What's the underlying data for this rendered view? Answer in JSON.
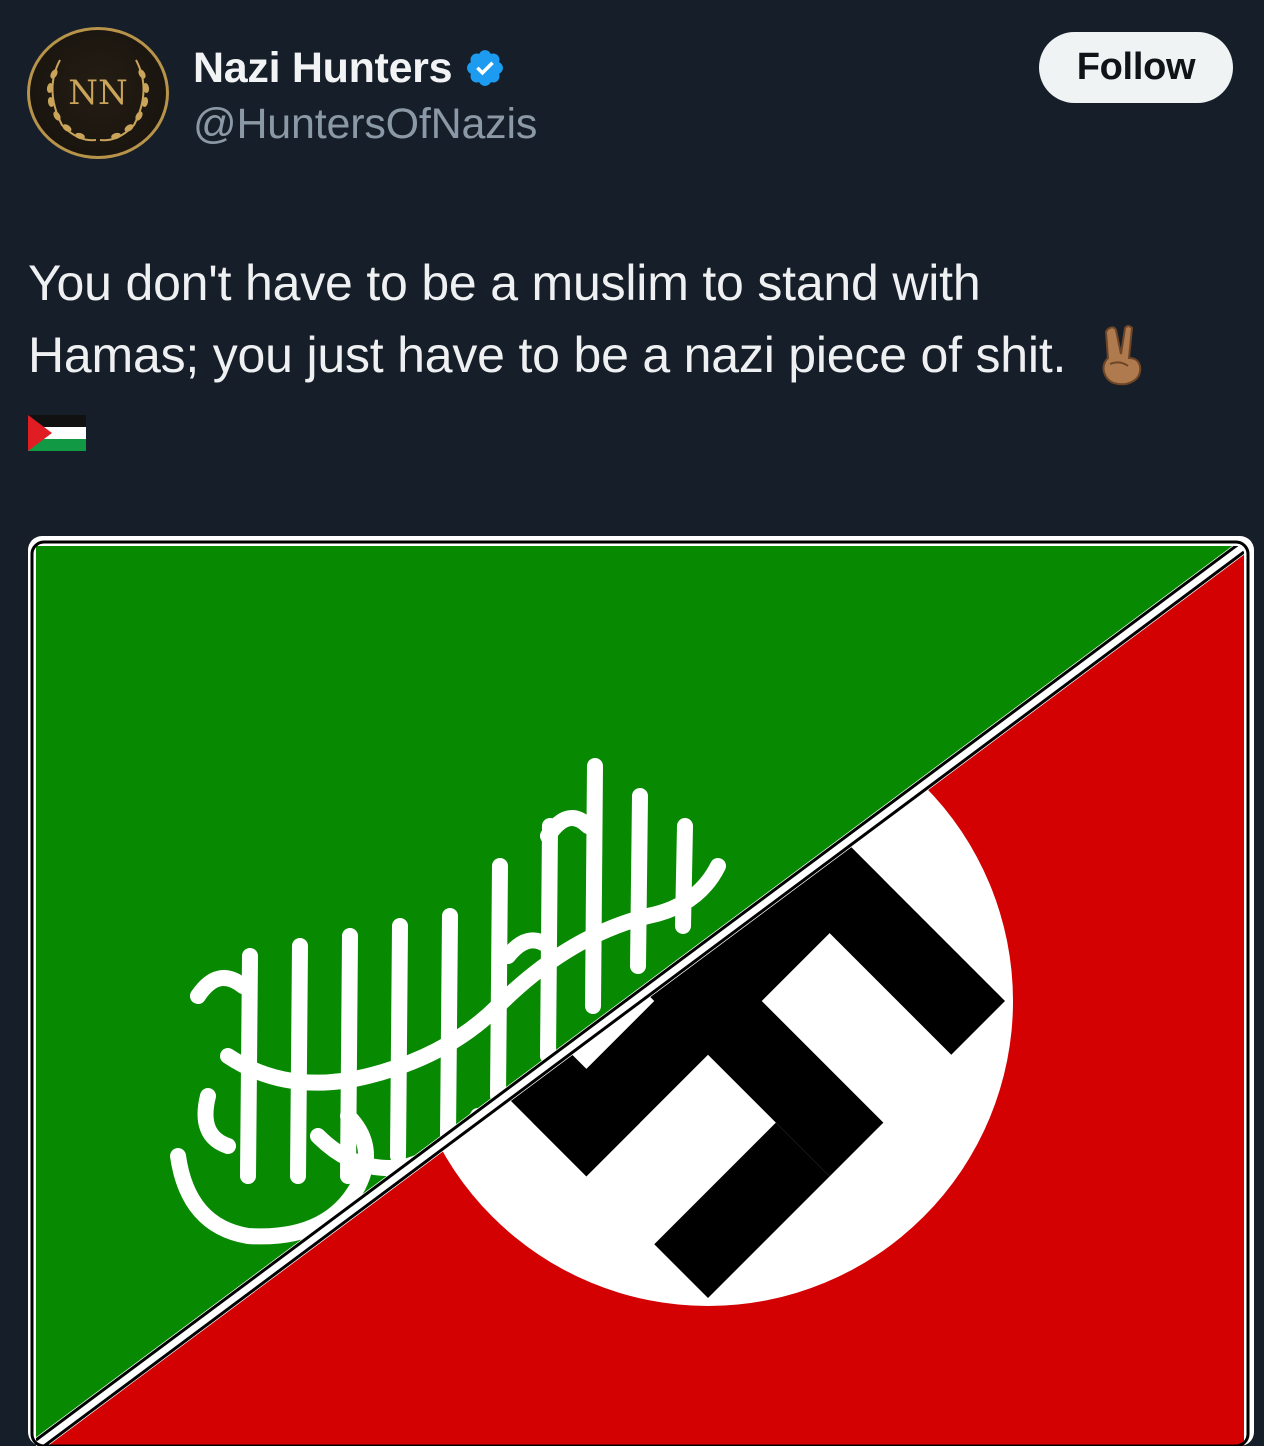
{
  "author": {
    "display_name": "Nazi Hunters",
    "handle": "@HuntersOfNazis",
    "avatar_monogram": "NN",
    "verified": true,
    "verified_color": "#1d9bf0"
  },
  "follow_button": {
    "label": "Follow"
  },
  "tweet": {
    "line1": "You don't have to be a muslim to stand with",
    "line2": "Hamas; you just have to be a nazi piece of shit.",
    "emojis": [
      "victory-hand-emoji",
      "palestine-flag-emoji"
    ]
  },
  "media": {
    "description_icon": "split-flag-image",
    "colors": {
      "green": "#078a01",
      "red": "#d40103",
      "white": "#ffffff",
      "black": "#000000"
    }
  },
  "theme": {
    "background": "#161e29",
    "text": "#e7e9ea",
    "muted": "#8b98a5"
  }
}
